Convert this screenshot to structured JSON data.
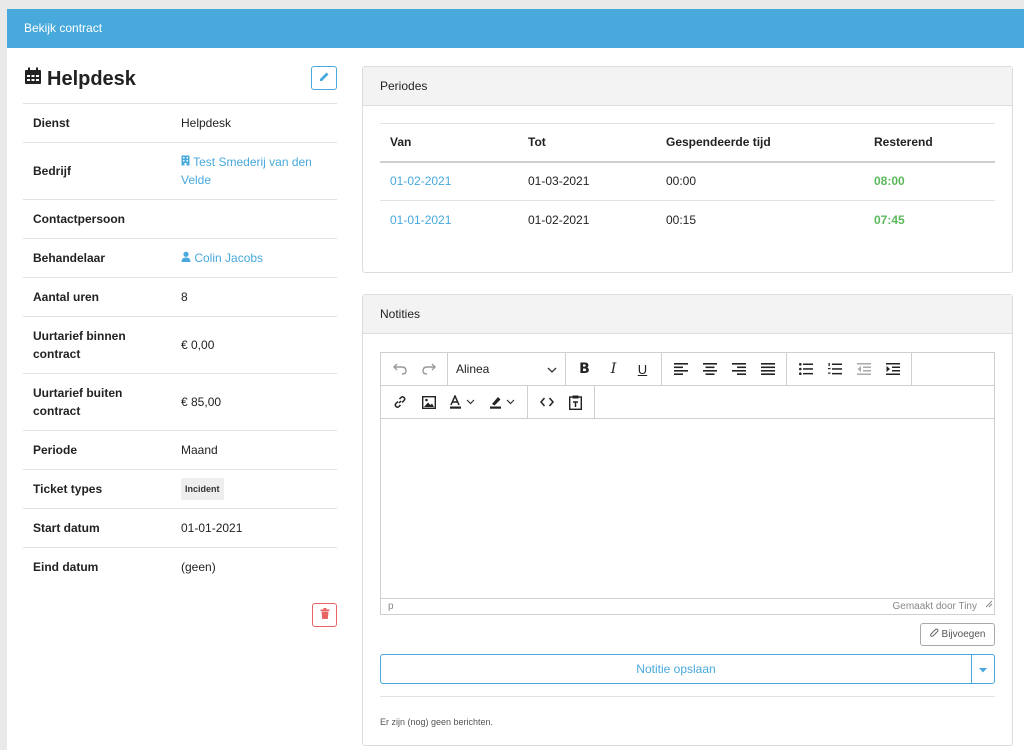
{
  "window": {
    "title": "Bekijk contract"
  },
  "contract": {
    "title": "Helpdesk",
    "rows": [
      {
        "label": "Dienst",
        "value": "Helpdesk"
      },
      {
        "label": "Bedrijf",
        "value": "Test Smederij van den Velde"
      },
      {
        "label": "Contactpersoon",
        "value": ""
      },
      {
        "label": "Behandelaar",
        "value": "Colin Jacobs"
      },
      {
        "label": "Aantal uren",
        "value": "8"
      },
      {
        "label": "Uurtarief binnen contract",
        "value": "€ 0,00"
      },
      {
        "label": "Uurtarief buiten contract",
        "value": "€ 85,00"
      },
      {
        "label": "Periode",
        "value": "Maand"
      },
      {
        "label": "Ticket types",
        "value": "Incident"
      },
      {
        "label": "Start datum",
        "value": "01-01-2021"
      },
      {
        "label": "Eind datum",
        "value": "(geen)"
      }
    ]
  },
  "periodes": {
    "title": "Periodes",
    "columns": [
      "Van",
      "Tot",
      "Gespendeerde tijd",
      "Resterend"
    ],
    "rows": [
      {
        "van": "01-02-2021",
        "tot": "01-03-2021",
        "tijd": "00:00",
        "rest": "08:00"
      },
      {
        "van": "01-01-2021",
        "tot": "01-02-2021",
        "tijd": "00:15",
        "rest": "07:45"
      }
    ]
  },
  "notities": {
    "title": "Notities",
    "block_format": "Alinea",
    "status_path": "p",
    "status_brand": "Gemaakt door Tiny",
    "attach_label": "Bijvoegen",
    "save_label": "Notitie opslaan",
    "empty_text": "Er zijn (nog) geen berichten."
  },
  "colors": {
    "accent": "#48a9dc",
    "danger": "#e86464",
    "success": "#5cb85c"
  }
}
